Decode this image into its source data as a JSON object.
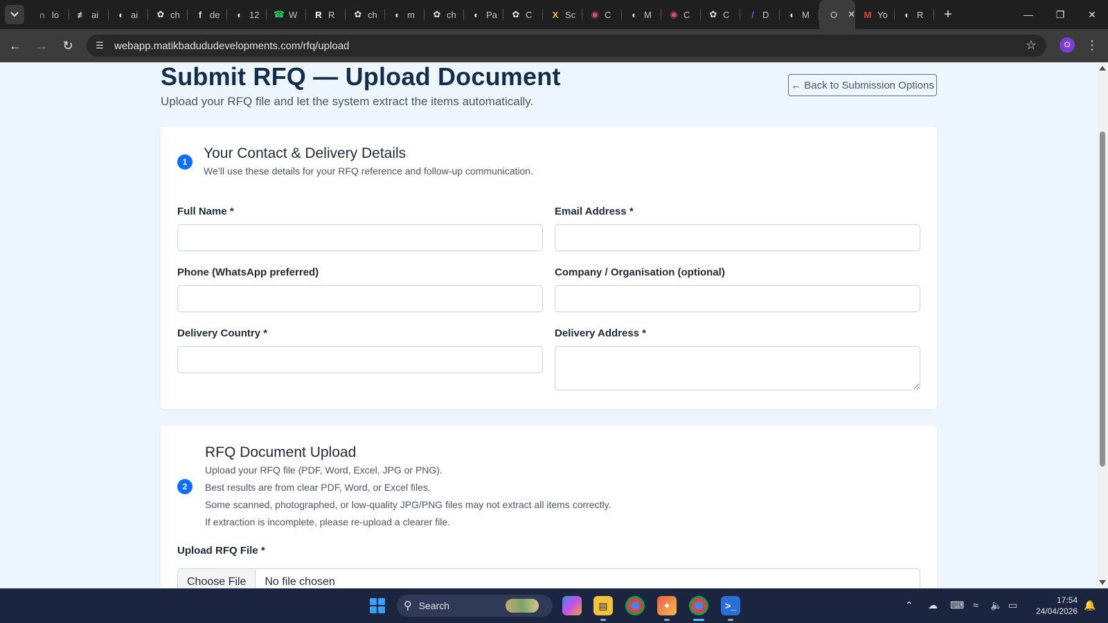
{
  "browser": {
    "tabs": [
      {
        "title": "lo",
        "icon": "lovable-icon",
        "color": "#e3e3e3",
        "glyph": "∩"
      },
      {
        "title": "ai",
        "icon": "figma-icon",
        "color": "#e3e3e3",
        "glyph": "≢"
      },
      {
        "title": "ai",
        "icon": "globe-icon",
        "color": "#e3e3e3",
        "glyph": "◐"
      },
      {
        "title": "ch",
        "icon": "openai-icon",
        "color": "#e3e3e3",
        "glyph": "✿"
      },
      {
        "title": "de",
        "icon": "facebook-icon",
        "color": "#e3e3e3",
        "glyph": "f"
      },
      {
        "title": "12",
        "icon": "globe-icon",
        "color": "#e3e3e3",
        "glyph": "◐"
      },
      {
        "title": "W",
        "icon": "whatsapp-icon",
        "color": "#25d366",
        "glyph": "☎"
      },
      {
        "title": "R",
        "icon": "r-icon",
        "color": "#ffffff",
        "glyph": "R"
      },
      {
        "title": "ch",
        "icon": "openai-icon",
        "color": "#e3e3e3",
        "glyph": "✿"
      },
      {
        "title": "m",
        "icon": "globe-icon",
        "color": "#e3e3e3",
        "glyph": "◐"
      },
      {
        "title": "ch",
        "icon": "openai-icon",
        "color": "#e3e3e3",
        "glyph": "✿"
      },
      {
        "title": "Pa",
        "icon": "globe-icon",
        "color": "#e3e3e3",
        "glyph": "◐"
      },
      {
        "title": "C",
        "icon": "openai-icon",
        "color": "#e3e3e3",
        "glyph": "✿"
      },
      {
        "title": "Sc",
        "icon": "x-icon",
        "color": "#e8c542",
        "glyph": "X"
      },
      {
        "title": "C",
        "icon": "app-icon",
        "color": "#e2478a",
        "glyph": "◉"
      },
      {
        "title": "M",
        "icon": "globe-icon",
        "color": "#e3e3e3",
        "glyph": "◐"
      },
      {
        "title": "C",
        "icon": "app-icon",
        "color": "#e2478a",
        "glyph": "◉"
      },
      {
        "title": "C",
        "icon": "openai-icon",
        "color": "#e3e3e3",
        "glyph": "✿"
      },
      {
        "title": "D",
        "icon": "pen-icon",
        "color": "#8a4cf0",
        "glyph": "/"
      },
      {
        "title": "M",
        "icon": "globe-icon",
        "color": "#e3e3e3",
        "glyph": "◐"
      }
    ],
    "active_tab": {
      "title": "O"
    },
    "tabs_after": [
      {
        "title": "Yo",
        "icon": "gmail-icon",
        "color": "#ea4335",
        "glyph": "M"
      },
      {
        "title": "R",
        "icon": "globe-icon",
        "color": "#e3e3e3",
        "glyph": "◐"
      }
    ],
    "url": "webapp.matikbadududevelopments.com/rfq/upload",
    "profile_initial": "O"
  },
  "page": {
    "title": "Submit RFQ — Upload Document",
    "subtitle": "Upload your RFQ file and let the system extract the items automatically.",
    "back_button": "← Back to Submission Options",
    "section1": {
      "step": "1",
      "title": "Your Contact & Delivery Details",
      "description": "We’ll use these details for your RFQ reference and follow-up communication.",
      "fields": {
        "full_name": {
          "label": "Full Name *",
          "value": ""
        },
        "email": {
          "label": "Email Address *",
          "value": ""
        },
        "phone": {
          "label": "Phone (WhatsApp preferred)",
          "value": ""
        },
        "company": {
          "label": "Company / Organisation (optional)",
          "value": ""
        },
        "country": {
          "label": "Delivery Country *",
          "value": ""
        },
        "address": {
          "label": "Delivery Address *",
          "value": ""
        }
      }
    },
    "section2": {
      "step": "2",
      "title": "RFQ Document Upload",
      "lines": [
        "Upload your RFQ file (PDF, Word, Excel, JPG or PNG).",
        "Best results are from clear PDF, Word, or Excel files.",
        "Some scanned, photographed, or low-quality JPG/PNG files may not extract all items correctly.",
        "If extraction is incomplete, please re-upload a clearer file."
      ],
      "upload_label": "Upload RFQ File *",
      "choose_file": "Choose File",
      "file_status": "No file chosen"
    }
  },
  "taskbar": {
    "search_text": "Search",
    "time": "17:54",
    "date": "24/04/2026"
  },
  "colors": {
    "accent": "#0d6efd",
    "title": "#142d4c",
    "page_bg": "#eef6fd"
  }
}
